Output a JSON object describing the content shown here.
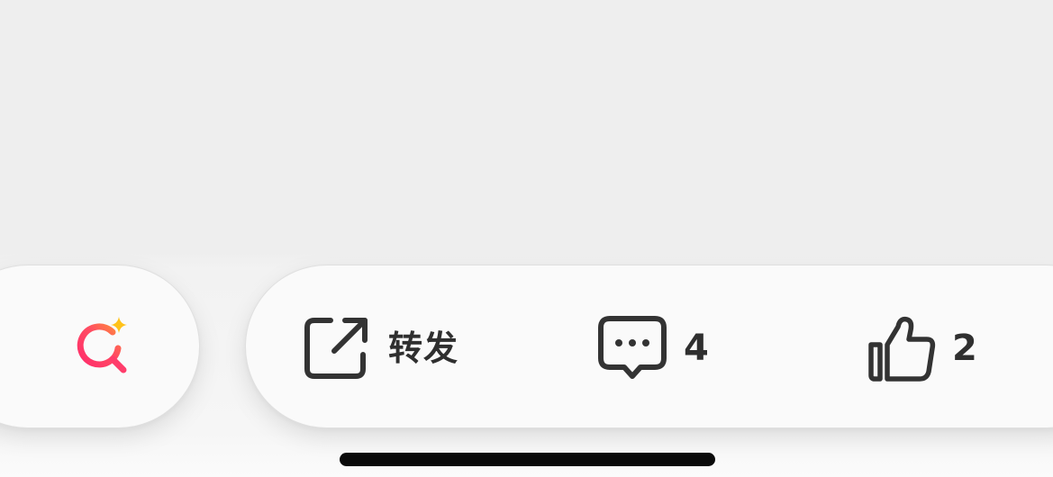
{
  "toolbar": {
    "search": {
      "icon": "ai-search-icon",
      "accent_colors": [
        "#ff3d6b",
        "#ff8a3d",
        "#ffc21a"
      ]
    },
    "share": {
      "icon": "share-icon",
      "label": "转发"
    },
    "comment": {
      "icon": "comment-icon",
      "count": "4"
    },
    "like": {
      "icon": "thumbs-up-icon",
      "count": "2"
    }
  },
  "system": {
    "home_indicator_color": "#0a0a0a"
  }
}
